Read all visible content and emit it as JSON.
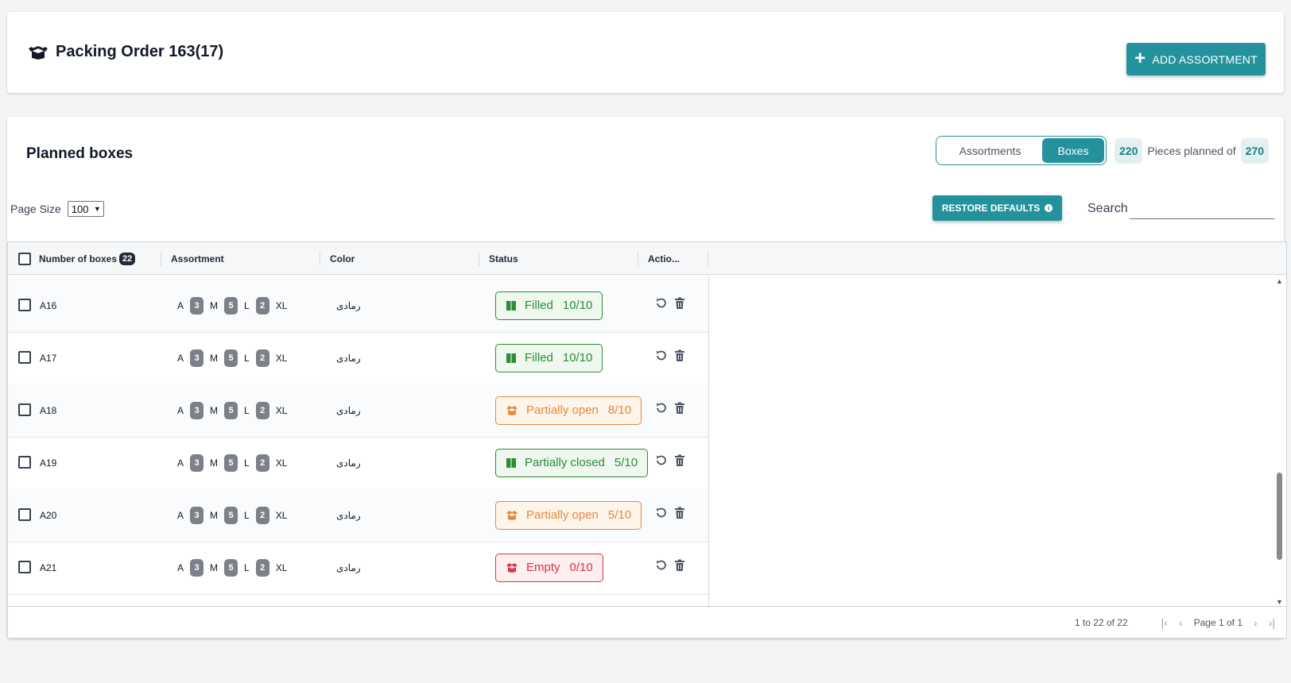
{
  "header": {
    "title": "Packing Order 163(17)",
    "add_button": "ADD ASSORTMENT"
  },
  "section": {
    "title": "Planned boxes",
    "toggle": {
      "assortments": "Assortments",
      "boxes": "Boxes",
      "active": "Boxes"
    },
    "pieces": {
      "planned": "220",
      "label": "Pieces planned of",
      "total": "270"
    }
  },
  "toolbar": {
    "page_size_label": "Page Size",
    "page_size_value": "100",
    "restore_button": "RESTORE DEFAULTS",
    "search_label": "Search",
    "search_value": ""
  },
  "table": {
    "columns": {
      "boxes": "Number of boxes",
      "boxes_count": "22",
      "assortment": "Assortment",
      "color": "Color",
      "status": "Status",
      "actions": "Actio..."
    },
    "rows": [
      {
        "name": "A16",
        "sizes": [
          "A",
          "3",
          "M",
          "5",
          "L",
          "2",
          "XL"
        ],
        "color": "رمادی",
        "status": "Filled",
        "count": "10/10",
        "kind": "filled"
      },
      {
        "name": "A17",
        "sizes": [
          "A",
          "3",
          "M",
          "5",
          "L",
          "2",
          "XL"
        ],
        "color": "رمادی",
        "status": "Filled",
        "count": "10/10",
        "kind": "filled"
      },
      {
        "name": "A18",
        "sizes": [
          "A",
          "3",
          "M",
          "5",
          "L",
          "2",
          "XL"
        ],
        "color": "رمادی",
        "status": "Partially open",
        "count": "8/10",
        "kind": "partial-open"
      },
      {
        "name": "A19",
        "sizes": [
          "A",
          "3",
          "M",
          "5",
          "L",
          "2",
          "XL"
        ],
        "color": "رمادی",
        "status": "Partially closed",
        "count": "5/10",
        "kind": "partial-closed"
      },
      {
        "name": "A20",
        "sizes": [
          "A",
          "3",
          "M",
          "5",
          "L",
          "2",
          "XL"
        ],
        "color": "رمادی",
        "status": "Partially open",
        "count": "5/10",
        "kind": "partial-open"
      },
      {
        "name": "A21",
        "sizes": [
          "A",
          "3",
          "M",
          "5",
          "L",
          "2",
          "XL"
        ],
        "color": "رمادی",
        "status": "Empty",
        "count": "0/10",
        "kind": "empty"
      }
    ]
  },
  "footer": {
    "range": "1 to 22 of 22",
    "page": "Page 1 of 1"
  },
  "colors": {
    "accent": "#23929c",
    "filled": "#2e8b37",
    "partial_open": "#e8893a",
    "empty": "#dc3548"
  },
  "icons": {
    "title": "open-box-icon",
    "add": "plus-icon",
    "restore_info": "info-icon",
    "row_reset": "undo-icon",
    "row_delete": "trash-icon"
  }
}
